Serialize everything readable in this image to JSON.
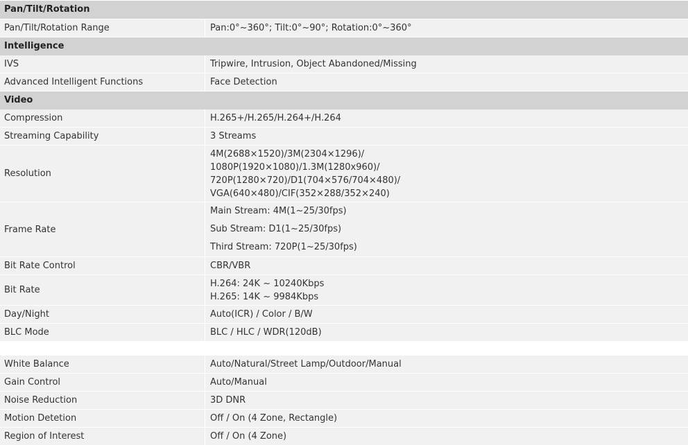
{
  "sections": {
    "pan_tilt": "Pan/Tilt/Rotation",
    "intelligence": "Intelligence",
    "video": "Video"
  },
  "rows": {
    "ptr_range": {
      "label": "Pan/Tilt/Rotation Range",
      "value": "Pan:0°~360°; Tilt:0°~90°; Rotation:0°~360°"
    },
    "ivs": {
      "label": "IVS",
      "value": "Tripwire, Intrusion, Object Abandoned/Missing"
    },
    "advanced": {
      "label": "Advanced Intelligent Functions",
      "value": "Face Detection"
    },
    "compression": {
      "label": "Compression",
      "value": "H.265+/H.265/H.264+/H.264"
    },
    "streaming": {
      "label": "Streaming Capability",
      "value": "3 Streams"
    },
    "resolution": {
      "label": "Resolution",
      "lines": [
        "4M(2688×1520)/3M(2304×1296)/",
        "1080P(1920×1080)/1.3M(1280x960)/",
        "720P(1280×720)/D1(704×576/704×480)/",
        "VGA(640×480)/CIF(352×288/352×240)"
      ]
    },
    "frame_rate": {
      "label": "Frame Rate",
      "lines": [
        "Main Stream: 4M(1~25/30fps)",
        "Sub Stream: D1(1~25/30fps)",
        "Third Stream: 720P(1~25/30fps)"
      ]
    },
    "bitrate_control": {
      "label": "Bit Rate Control",
      "value": "CBR/VBR"
    },
    "bitrate": {
      "label": "Bit Rate",
      "lines": [
        "H.264: 24K ~ 10240Kbps",
        "H.265: 14K ~ 9984Kbps"
      ]
    },
    "day_night": {
      "label": "Day/Night",
      "value": "Auto(ICR) / Color / B/W"
    },
    "blc": {
      "label": "BLC Mode",
      "value": "BLC / HLC / WDR(120dB)"
    },
    "white_balance": {
      "label": "White Balance",
      "value": "Auto/Natural/Street Lamp/Outdoor/Manual"
    },
    "gain": {
      "label": "Gain Control",
      "value": "Auto/Manual"
    },
    "noise": {
      "label": "Noise Reduction",
      "value": "3D DNR"
    },
    "motion": {
      "label": "Motion Detetion",
      "value": "Off / On (4 Zone, Rectangle)"
    },
    "roi": {
      "label": "Region of Interest",
      "value": "Off / On (4 Zone)"
    }
  }
}
